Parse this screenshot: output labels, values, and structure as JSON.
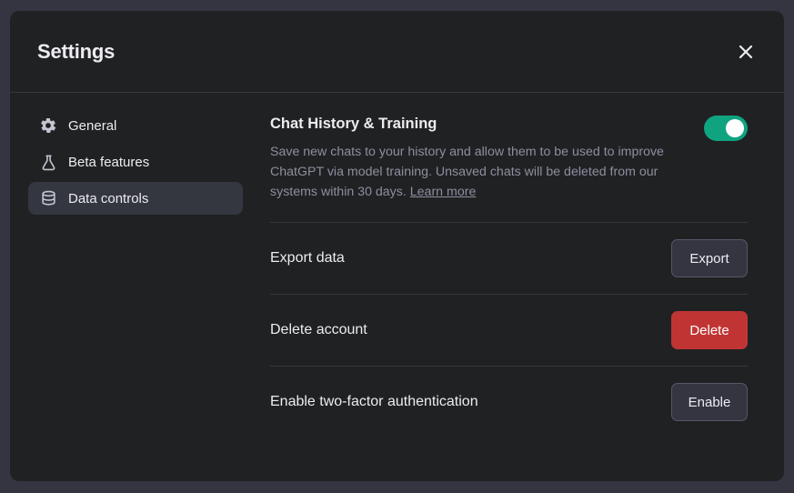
{
  "dialog": {
    "title": "Settings"
  },
  "sidebar": {
    "items": [
      {
        "label": "General"
      },
      {
        "label": "Beta features"
      },
      {
        "label": "Data controls"
      }
    ]
  },
  "content": {
    "history": {
      "title": "Chat History & Training",
      "description": "Save new chats to your history and allow them to be used to improve ChatGPT via model training. Unsaved chats will be deleted from our systems within 30 days.",
      "learn_more": "Learn more",
      "toggle_on": true
    },
    "export": {
      "label": "Export data",
      "button": "Export"
    },
    "delete": {
      "label": "Delete account",
      "button": "Delete"
    },
    "twofa": {
      "label": "Enable two-factor authentication",
      "button": "Enable"
    }
  }
}
